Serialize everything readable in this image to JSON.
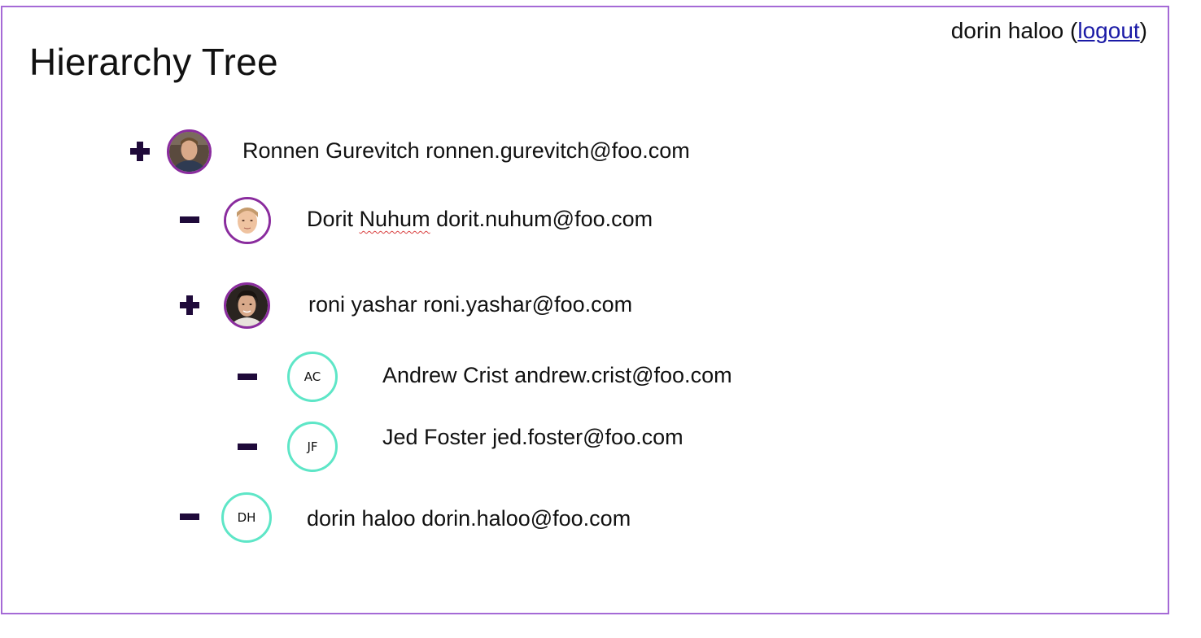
{
  "page": {
    "title": "Hierarchy Tree"
  },
  "header": {
    "user_name": "dorin haloo",
    "open_paren": "(",
    "logout_label": "logout",
    "close_paren": ")"
  },
  "colors": {
    "frame_border": "#a56ad6",
    "photo_avatar_border": "#8a2c9e",
    "initials_avatar_border": "#5ee6c7",
    "toggle_icon": "#1f0a3a",
    "link": "#1a1aa6",
    "spellcheck_underline": "#d94141"
  },
  "tree": {
    "nodes": [
      {
        "toggle": "plus-icon",
        "avatar_type": "photo",
        "avatar_icon": "person-photo",
        "name": "Ronnen Gurevitch",
        "email": "ronnen.gurevitch@foo.com"
      },
      {
        "toggle": "minus-icon",
        "avatar_type": "photo",
        "avatar_icon": "person-photo",
        "name_first": "Dorit",
        "name_last": "Nuhum",
        "email": "dorit.nuhum@foo.com"
      },
      {
        "toggle": "plus-icon",
        "avatar_type": "photo",
        "avatar_icon": "person-photo",
        "name": "roni yashar",
        "email": "roni.yashar@foo.com"
      },
      {
        "toggle": "minus-icon",
        "avatar_type": "initials",
        "initials": "AC",
        "name": "Andrew Crist",
        "email": "andrew.crist@foo.com"
      },
      {
        "toggle": "minus-icon",
        "avatar_type": "initials",
        "initials": "JF",
        "name": "Jed Foster",
        "email": "jed.foster@foo.com"
      },
      {
        "toggle": "minus-icon",
        "avatar_type": "initials",
        "initials": "DH",
        "name": "dorin haloo",
        "email": "dorin.haloo@foo.com"
      }
    ]
  }
}
